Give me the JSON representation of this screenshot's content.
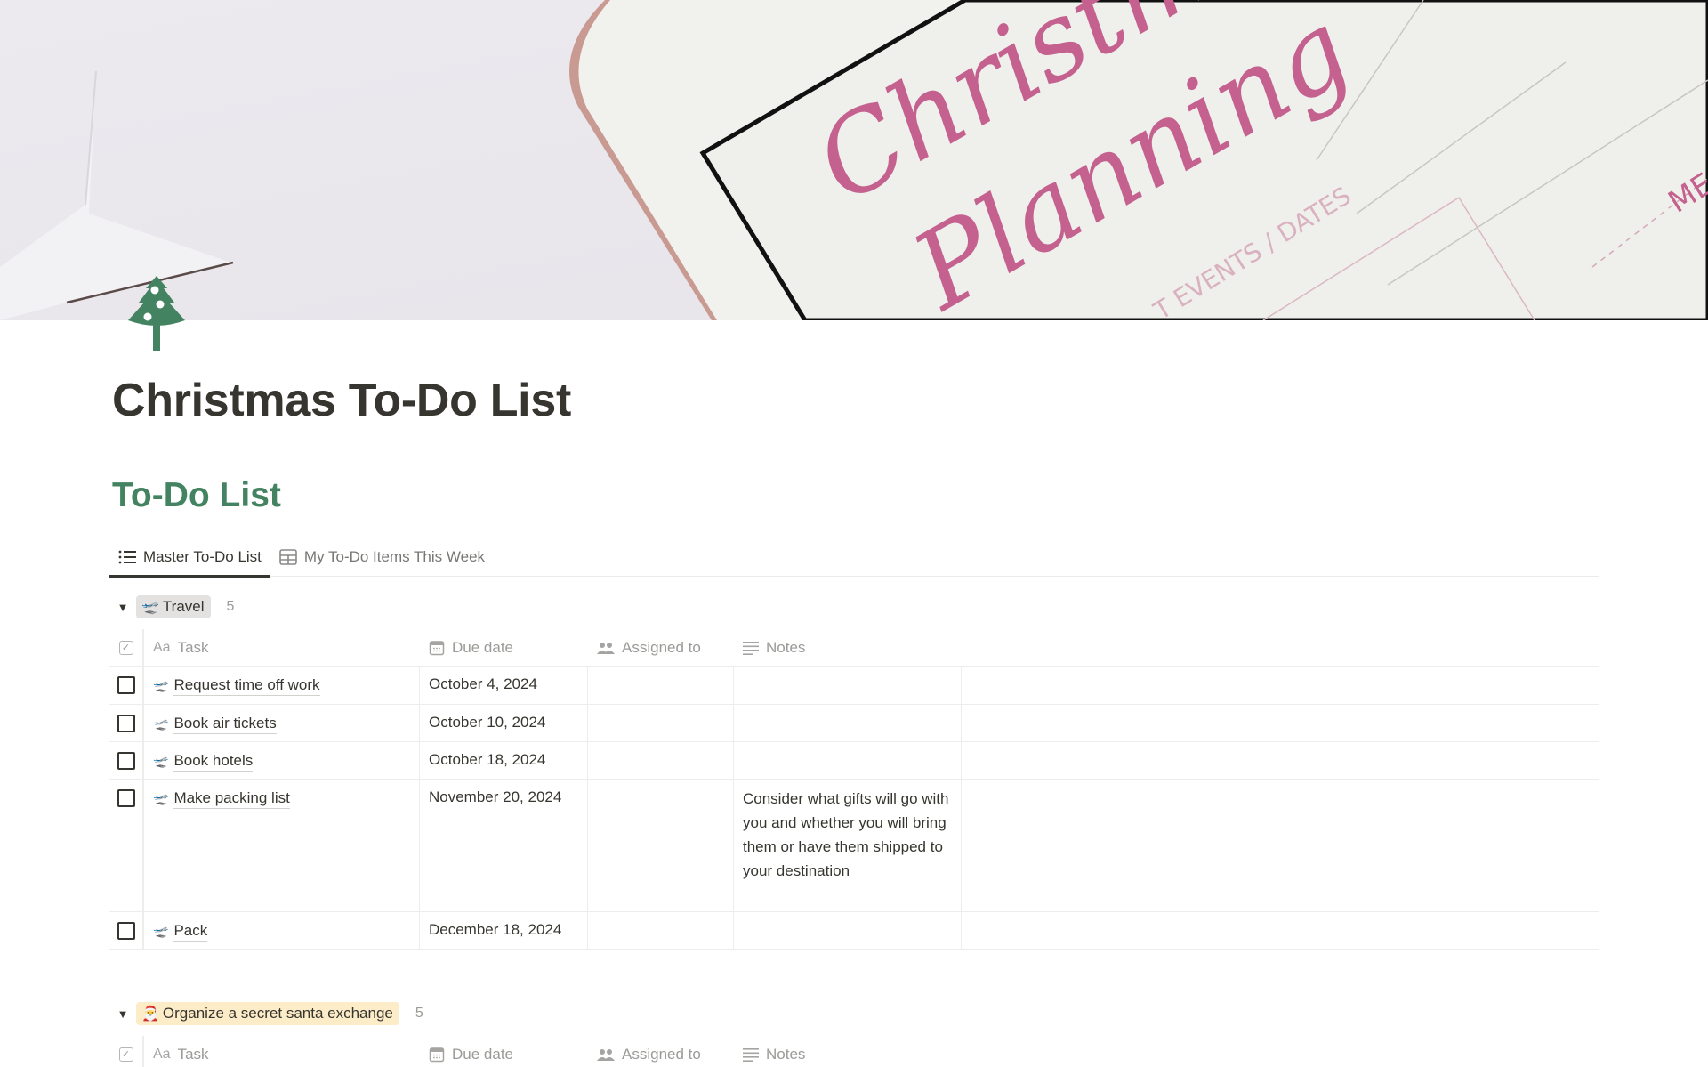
{
  "cover": {
    "image_description": "Christmas Planning notebook cover photo",
    "script_text_line1": "Christm",
    "script_text_line2": "Planning",
    "print_text": "T EVENTS / DATES",
    "corner_text": "ME",
    "accent_pink": "#c4618e"
  },
  "page": {
    "icon": "christmas-tree-icon",
    "icon_color": "#448361",
    "title": "Christmas To-Do List"
  },
  "section": {
    "heading": "To-Do List",
    "heading_color": "#448361"
  },
  "tabs": [
    {
      "label": "Master To-Do List",
      "icon": "list-icon",
      "active": true
    },
    {
      "label": "My To-Do Items This Week",
      "icon": "table-icon",
      "active": false
    }
  ],
  "columns": {
    "task": "Task",
    "due_date": "Due date",
    "assigned_to": "Assigned to",
    "notes": "Notes"
  },
  "groups": [
    {
      "name": "Travel",
      "emoji": "🛫",
      "count": "5",
      "tag_color": "#e3e2e0",
      "rows": [
        {
          "done": false,
          "emoji": "🛫",
          "task": "Request time off work",
          "due": "October 4, 2024",
          "assigned": "",
          "notes": ""
        },
        {
          "done": false,
          "emoji": "🛫",
          "task": "Book air tickets",
          "due": "October 10, 2024",
          "assigned": "",
          "notes": ""
        },
        {
          "done": false,
          "emoji": "🛫",
          "task": "Book hotels",
          "due": "October 18, 2024",
          "assigned": "",
          "notes": ""
        },
        {
          "done": false,
          "emoji": "🛫",
          "task": "Make packing list",
          "due": "November 20, 2024",
          "assigned": "",
          "notes": "Consider what gifts will go with you and whether you will bring them or have them shipped to your destination"
        },
        {
          "done": false,
          "emoji": "🛫",
          "task": "Pack",
          "due": "December 18, 2024",
          "assigned": "",
          "notes": ""
        }
      ]
    },
    {
      "name": "Organize a secret santa exchange",
      "emoji": "🎅",
      "count": "5",
      "tag_color": "#fdecc8",
      "rows": []
    }
  ]
}
